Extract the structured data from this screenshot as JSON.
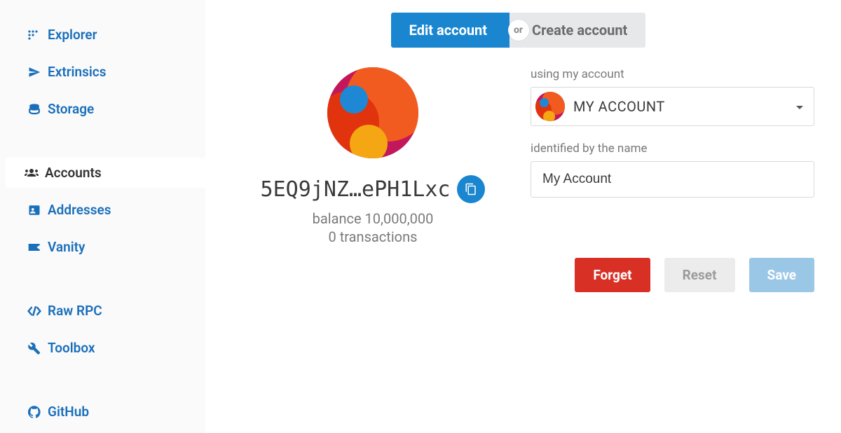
{
  "sidebar": {
    "items": [
      {
        "label": "Explorer",
        "icon": "grid-dots-icon"
      },
      {
        "label": "Extrinsics",
        "icon": "paper-plane-icon"
      },
      {
        "label": "Storage",
        "icon": "database-icon"
      },
      {
        "label": "Accounts",
        "icon": "users-icon",
        "active": true
      },
      {
        "label": "Addresses",
        "icon": "address-card-icon"
      },
      {
        "label": "Vanity",
        "icon": "flag-icon"
      },
      {
        "label": "Raw RPC",
        "icon": "code-icon"
      },
      {
        "label": "Toolbox",
        "icon": "wrench-icon"
      },
      {
        "label": "GitHub",
        "icon": "github-icon"
      }
    ]
  },
  "tabs": {
    "edit": "Edit account",
    "or": "or",
    "create": "Create account"
  },
  "account": {
    "address_short": "5EQ9jNZ…ePH1Lxc",
    "balance_label": "balance 10,000,000",
    "transactions_label": "0 transactions"
  },
  "form": {
    "using_label": "using my account",
    "account_selected": "MY ACCOUNT",
    "name_label": "identified by the name",
    "name_value": "My Account"
  },
  "actions": {
    "forget": "Forget",
    "reset": "Reset",
    "save": "Save"
  }
}
